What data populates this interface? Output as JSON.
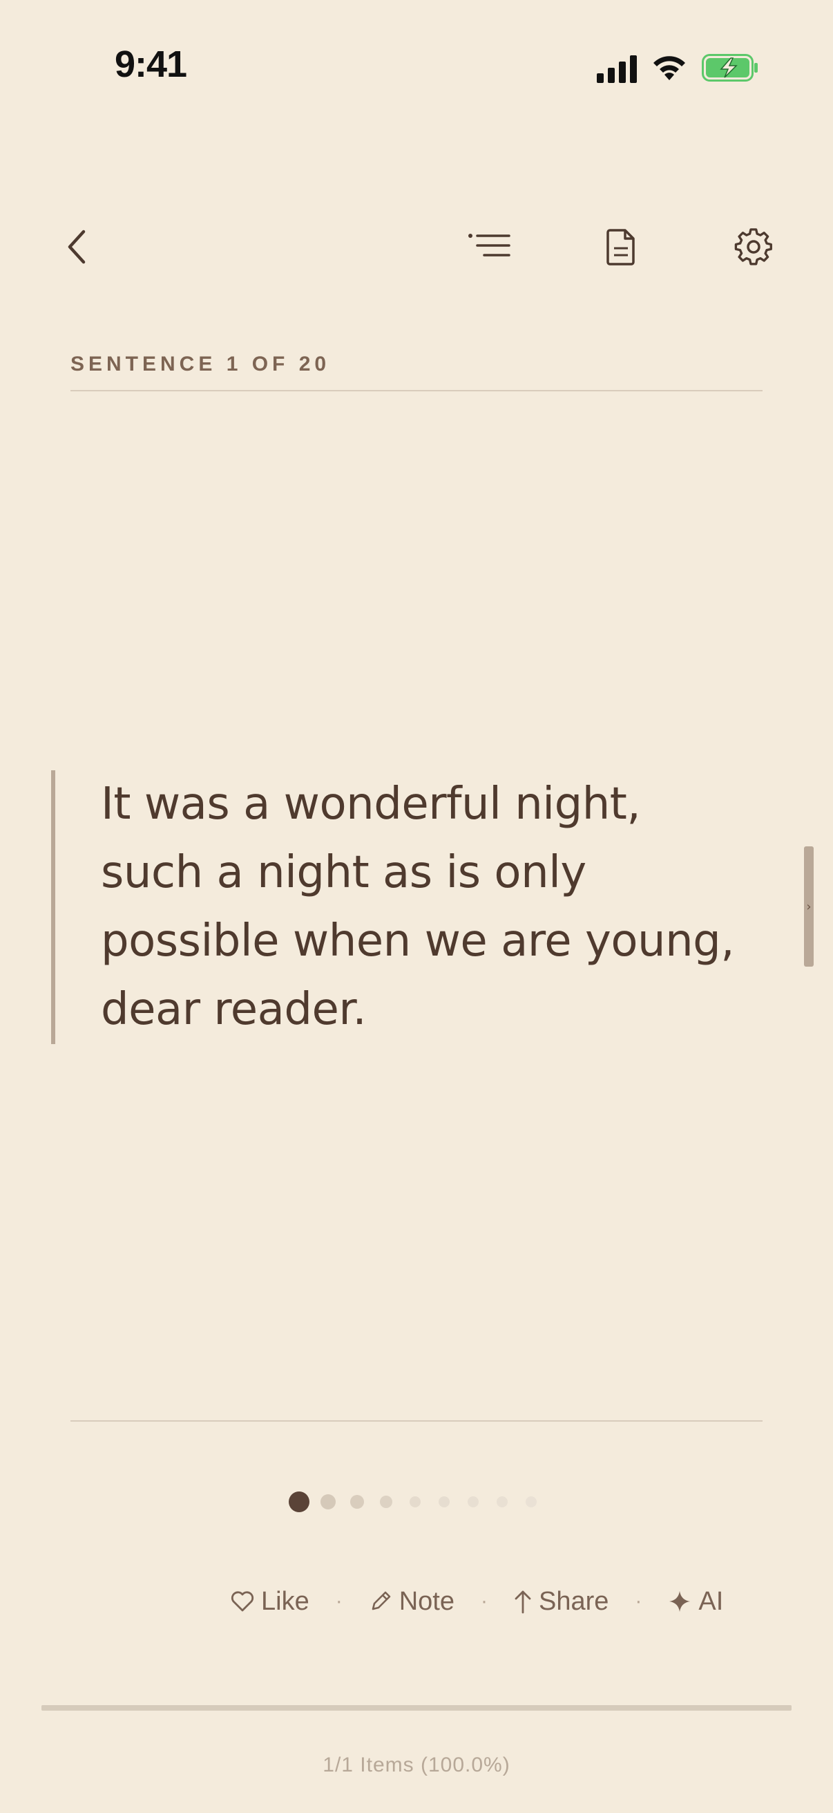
{
  "status_bar": {
    "time": "9:41",
    "icons": [
      "cellular-signal-icon",
      "wifi-icon",
      "battery-charging-icon"
    ]
  },
  "toolbar": {
    "back_icon": "chevron-left-icon",
    "contents_icon": "list-icon",
    "document_icon": "document-icon",
    "settings_icon": "gear-icon"
  },
  "reader": {
    "sentence_label": "SENTENCE 1 OF 20",
    "quote": "It was a wonderful night, such a night as is only possible when we are young, dear reader.",
    "side_handle_glyph": "›"
  },
  "pagination": {
    "dot_count": 9,
    "active_index": 0
  },
  "actions": [
    {
      "icon": "heart-icon",
      "label": "Like"
    },
    {
      "icon": "pencil-icon",
      "label": "Note"
    },
    {
      "icon": "arrow-up-icon",
      "label": "Share"
    },
    {
      "icon": "sparkle-icon",
      "label": "AI"
    }
  ],
  "action_separator": "·",
  "progress": {
    "fraction": 1.0,
    "label": "1/1 Items (100.0%)"
  },
  "colors": {
    "background": "#f4ebdc",
    "text": "#4f3a2e",
    "accent_bar": "#b9a897",
    "battery_fill": "#5cc86a"
  }
}
